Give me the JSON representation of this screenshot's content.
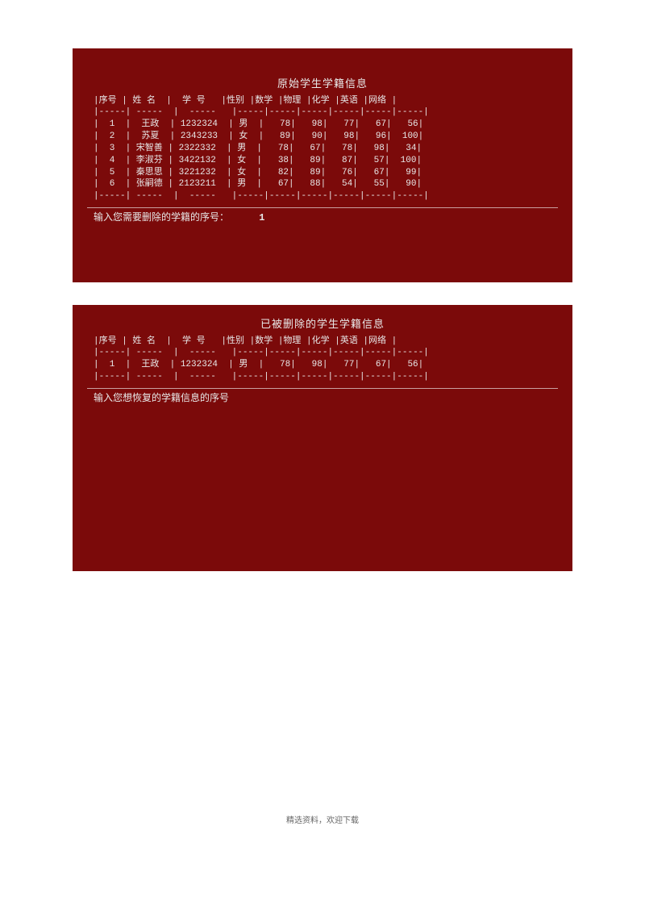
{
  "top": {
    "title": "原始学生学籍信息",
    "headers": [
      "序号",
      "姓 名",
      "学 号",
      "性别",
      "数学",
      "物理",
      "化学",
      "英语",
      "网络"
    ],
    "rows": [
      {
        "idx": "1",
        "name": "王政",
        "sid": "1232324",
        "sex": "男",
        "math": "78",
        "phy": "98",
        "chem": "77",
        "eng": "67",
        "net": "56"
      },
      {
        "idx": "2",
        "name": "苏夏",
        "sid": "2343233",
        "sex": "女",
        "math": "89",
        "phy": "90",
        "chem": "98",
        "eng": "96",
        "net": "100"
      },
      {
        "idx": "3",
        "name": "宋智善",
        "sid": "2322332",
        "sex": "男",
        "math": "78",
        "phy": "67",
        "chem": "78",
        "eng": "98",
        "net": "34"
      },
      {
        "idx": "4",
        "name": "李淑芬",
        "sid": "3422132",
        "sex": "女",
        "math": "38",
        "phy": "89",
        "chem": "87",
        "eng": "57",
        "net": "100"
      },
      {
        "idx": "5",
        "name": "秦思思",
        "sid": "3221232",
        "sex": "女",
        "math": "82",
        "phy": "89",
        "chem": "76",
        "eng": "67",
        "net": "99"
      },
      {
        "idx": "6",
        "name": "张嗣德",
        "sid": "2123211",
        "sex": "男",
        "math": "67",
        "phy": "88",
        "chem": "54",
        "eng": "55",
        "net": "90"
      }
    ],
    "prompt": "输入您需要删除的学籍的序号：",
    "prompt_value": "1"
  },
  "bottom": {
    "title": "已被删除的学生学籍信息",
    "headers": [
      "序号",
      "姓 名",
      "学 号",
      "性别",
      "数学",
      "物理",
      "化学",
      "英语",
      "网络"
    ],
    "rows": [
      {
        "idx": "1",
        "name": "王政",
        "sid": "1232324",
        "sex": "男",
        "math": "78",
        "phy": "98",
        "chem": "77",
        "eng": "67",
        "net": "56"
      }
    ],
    "prompt": "输入您想恢复的学籍信息的序号"
  },
  "footer": "精选资料，欢迎下载",
  "chart_data": {
    "type": "table",
    "tables": [
      {
        "title": "原始学生学籍信息",
        "columns": [
          "序号",
          "姓 名",
          "学 号",
          "性别",
          "数学",
          "物理",
          "化学",
          "英语",
          "网络"
        ],
        "rows": [
          [
            "1",
            "王政",
            "1232324",
            "男",
            78,
            98,
            77,
            67,
            56
          ],
          [
            "2",
            "苏夏",
            "2343233",
            "女",
            89,
            90,
            98,
            96,
            100
          ],
          [
            "3",
            "宋智善",
            "2322332",
            "男",
            78,
            67,
            78,
            98,
            34
          ],
          [
            "4",
            "李淑芬",
            "3422132",
            "女",
            38,
            89,
            87,
            57,
            100
          ],
          [
            "5",
            "秦思思",
            "3221232",
            "女",
            82,
            89,
            76,
            67,
            99
          ],
          [
            "6",
            "张嗣德",
            "2123211",
            "男",
            67,
            88,
            54,
            55,
            90
          ]
        ]
      },
      {
        "title": "已被删除的学生学籍信息",
        "columns": [
          "序号",
          "姓 名",
          "学 号",
          "性别",
          "数学",
          "物理",
          "化学",
          "英语",
          "网络"
        ],
        "rows": [
          [
            "1",
            "王政",
            "1232324",
            "男",
            78,
            98,
            77,
            67,
            56
          ]
        ]
      }
    ]
  }
}
